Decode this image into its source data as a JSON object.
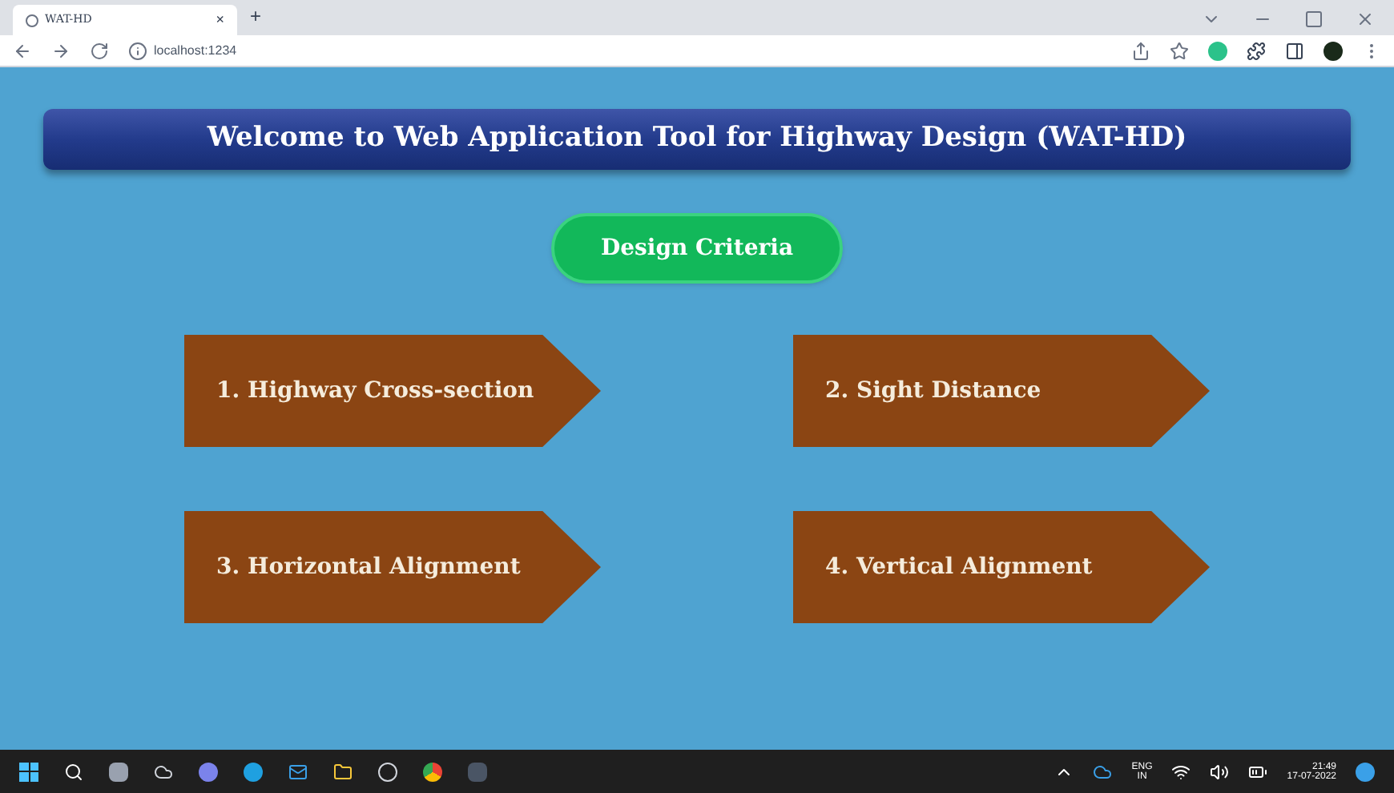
{
  "browser": {
    "tab": {
      "title": "WAT-HD",
      "close": "×"
    },
    "new_tab": "+",
    "url": "localhost:1234"
  },
  "header": {
    "title": "Welcome to Web Application Tool for Highway Design (WAT-HD)"
  },
  "design_criteria": {
    "label": "Design Criteria"
  },
  "modules": [
    {
      "label": "1. Highway Cross-section"
    },
    {
      "label": "2. Sight Distance"
    },
    {
      "label": "3. Horizontal Alignment"
    },
    {
      "label": "4. Vertical Alignment"
    }
  ],
  "taskbar": {
    "language": "ENG",
    "region": "IN",
    "time": "21:49",
    "date": "17-07-2022"
  }
}
